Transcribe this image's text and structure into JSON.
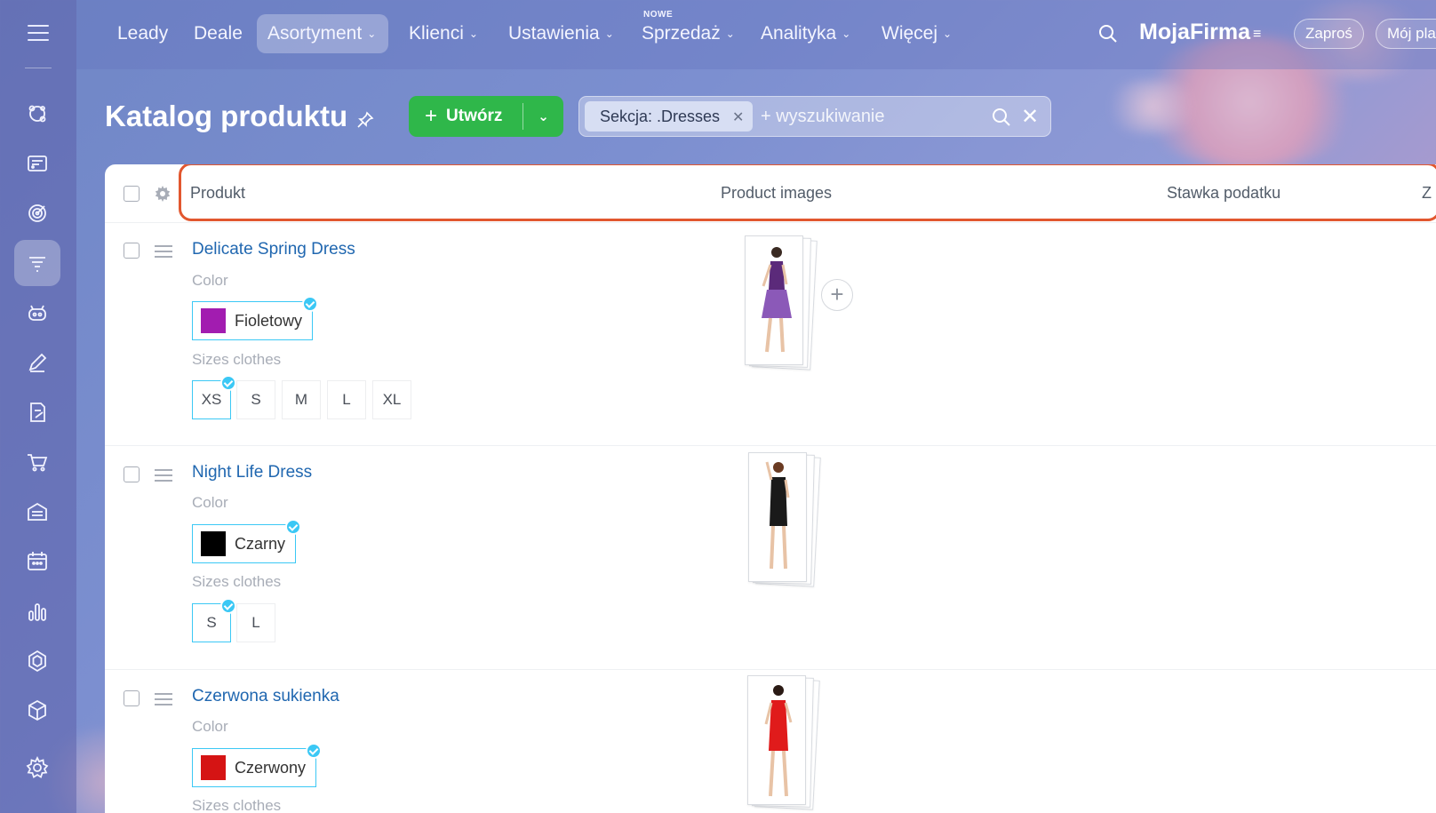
{
  "nav": {
    "items": [
      {
        "label": "Leady",
        "dropdown": false
      },
      {
        "label": "Deale",
        "dropdown": false
      },
      {
        "label": "Asortyment",
        "dropdown": true,
        "active": true
      },
      {
        "label": "Klienci",
        "dropdown": true
      },
      {
        "label": "Ustawienia",
        "dropdown": true
      },
      {
        "label": "Sprzedaż",
        "dropdown": true,
        "badge": "NOWE"
      },
      {
        "label": "Analityka",
        "dropdown": true
      },
      {
        "label": "Więcej",
        "dropdown": true
      }
    ],
    "brand": "MojaFirma",
    "invite_label": "Zaproś",
    "plan_label": "Mój pla"
  },
  "sidebar": {
    "icons": [
      "crm-icon",
      "contact-center-icon",
      "target-icon",
      "filter-funnel-icon",
      "robot-icon",
      "edit-icon",
      "document-sign-icon",
      "cart-icon",
      "warehouse-icon",
      "calendar-icon",
      "analytics-bars-icon",
      "hexagon-icon",
      "package-icon",
      "settings-icon"
    ],
    "active_index": 3
  },
  "page": {
    "title": "Katalog produktu",
    "create_label": "Utwórz",
    "filter_tag": "Sekcja: .Dresses",
    "search_placeholder": "+ wyszukiwanie"
  },
  "grid": {
    "columns": [
      "Produkt",
      "Product images",
      "Stawka podatku",
      "Z"
    ],
    "color_label": "Color",
    "sizes_label": "Sizes clothes",
    "rows": [
      {
        "name": "Delicate Spring Dress",
        "color_name": "Fioletowy",
        "color_hex": "#a21cb0",
        "sizes": [
          "XS",
          "S",
          "M",
          "L",
          "XL"
        ],
        "selected_size": "XS",
        "dress_hex": "#5b2a7a"
      },
      {
        "name": "Night Life Dress",
        "color_name": "Czarny",
        "color_hex": "#000000",
        "sizes": [
          "S",
          "L"
        ],
        "selected_size": "S",
        "dress_hex": "#1a1a1a"
      },
      {
        "name": "Czerwona sukienka",
        "color_name": "Czerwony",
        "color_hex": "#d51414",
        "sizes": [],
        "selected_size": "",
        "dress_hex": "#e01b1b"
      }
    ]
  },
  "colors": {
    "accent_green": "#2fb74a",
    "link_blue": "#2067b0",
    "highlight_orange": "#e2572f",
    "selected_cyan": "#3bc8f5"
  }
}
